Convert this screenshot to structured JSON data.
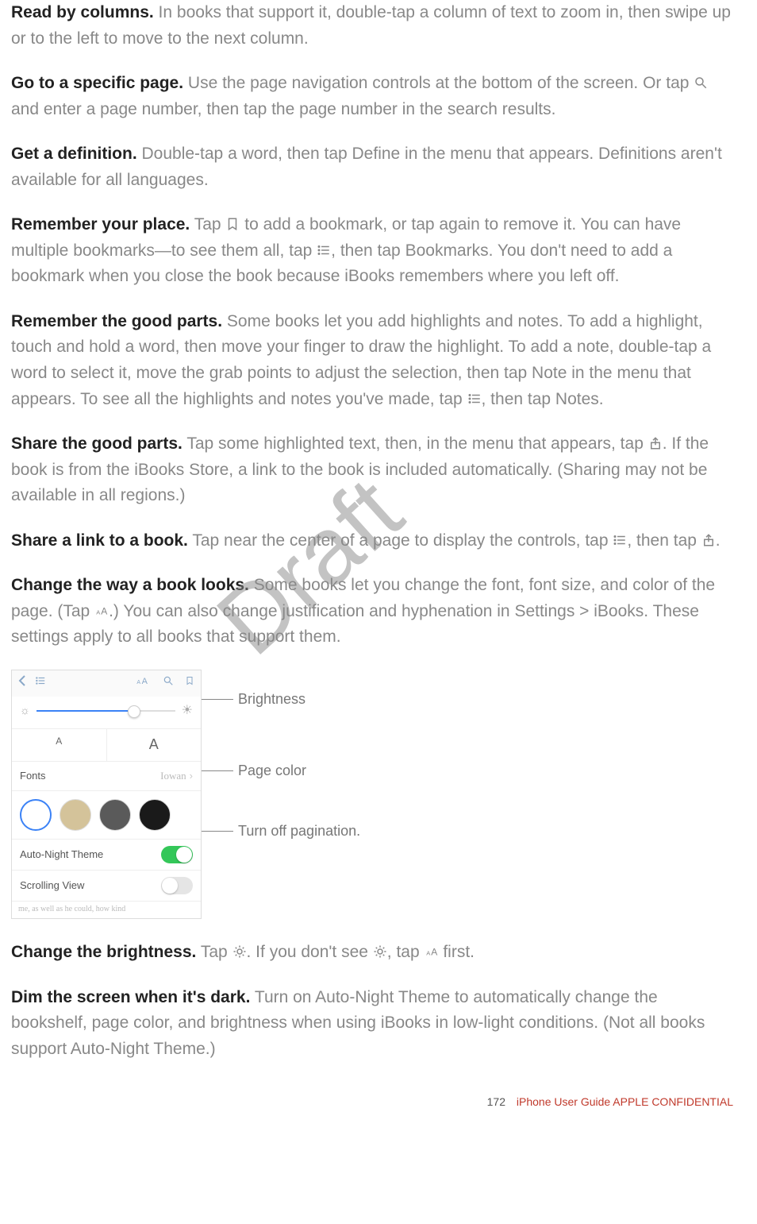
{
  "watermark": "Draft",
  "paragraphs": {
    "p1": {
      "lead": "Read by columns.",
      "body": " In books that support it, double-tap a column of text to zoom in, then swipe up or to the left to move to the next column."
    },
    "p2": {
      "lead": "Go to a specific page.",
      "body_a": " Use the page navigation controls at the bottom of the screen. Or tap ",
      "body_b": " and enter a page number, then tap the page number in the search results."
    },
    "p3": {
      "lead": "Get a definition.",
      "body": " Double-tap a word, then tap Define in the menu that appears. Definitions aren't available for all languages."
    },
    "p4": {
      "lead": "Remember your place.",
      "body_a": " Tap ",
      "body_b": " to add a bookmark, or tap again to remove it. You can have multiple bookmarks—to see them all, tap ",
      "body_c": ", then tap Bookmarks. You don't need to add a bookmark when you close the book because iBooks remembers where you left off."
    },
    "p5": {
      "lead": "Remember the good parts.",
      "body_a": " Some books let you add highlights and notes. To add a highlight, touch and hold a word, then move your finger to draw the highlight. To add a note, double-tap a word to select it, move the grab points to adjust the selection, then tap Note in the menu that appears. To see all the highlights and notes you've made, tap ",
      "body_b": ", then tap Notes."
    },
    "p6": {
      "lead": "Share the good parts.",
      "body_a": " Tap some highlighted text, then, in the menu that appears, tap ",
      "body_b": ". If the book is from the iBooks Store, a link to the book is included automatically. (Sharing may not be available in all regions.)"
    },
    "p7": {
      "lead": "Share a link to a book.",
      "body_a": " Tap near the center of a page to display the controls, tap ",
      "body_b": ", then tap ",
      "body_c": "."
    },
    "p8": {
      "lead": "Change the way a book looks.",
      "body_a": " Some books let you change the font, font size, and color of the page. (Tap ",
      "body_b": ".) You can also change justification and hyphenation in Settings > iBooks. These settings apply to all books that support them."
    },
    "p9": {
      "lead": "Change the brightness.",
      "body_a": " Tap ",
      "body_b": ". If you don't see ",
      "body_c": ", tap ",
      "body_d": " first."
    },
    "p10": {
      "lead": "Dim the screen when it's dark.",
      "body": " Turn on Auto-Night Theme to automatically change the bookshelf, page color, and brightness when using iBooks in low-light conditions. (Not all books support Auto-Night Theme.)"
    }
  },
  "panel": {
    "fonts_label": "Fonts",
    "fonts_value": "Iowan",
    "auto_night_label": "Auto-Night Theme",
    "scrolling_label": "Scrolling View",
    "cut_text": "me, as well as he could, how kind"
  },
  "callouts": {
    "brightness": "Brightness",
    "page_color": "Page color",
    "pagination": "Turn off pagination."
  },
  "footer": {
    "page": "172",
    "text": "iPhone User Guide  APPLE CONFIDENTIAL"
  }
}
